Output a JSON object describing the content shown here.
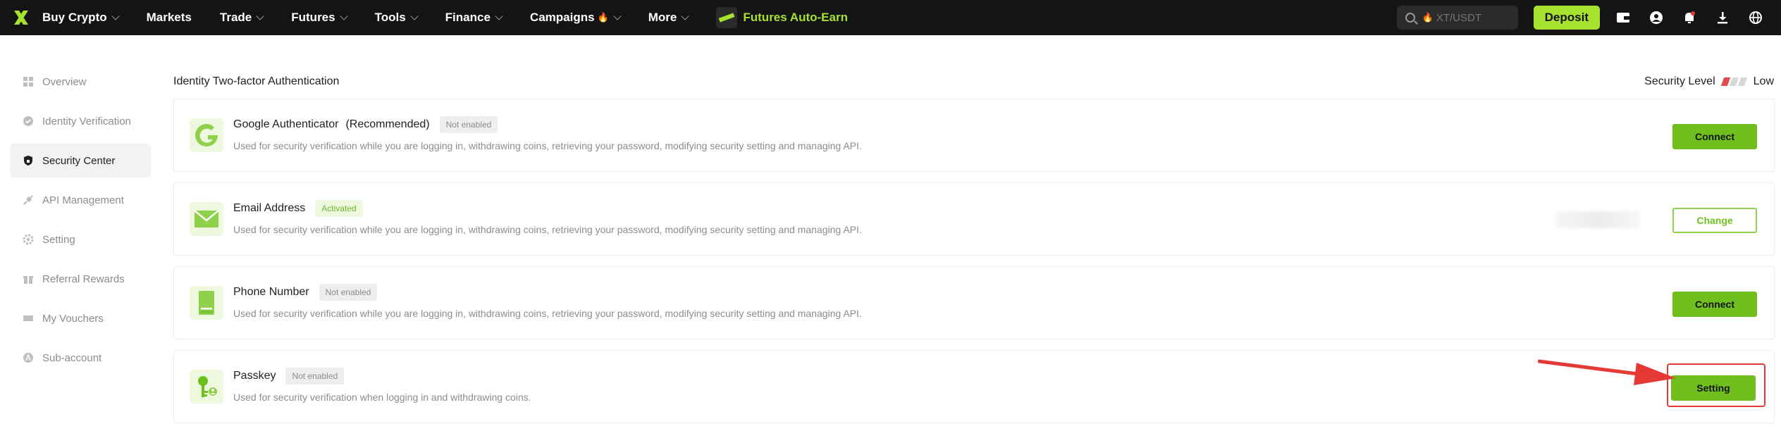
{
  "nav": {
    "items": [
      {
        "label": "Buy Crypto",
        "dropdown": true
      },
      {
        "label": "Markets",
        "dropdown": false
      },
      {
        "label": "Trade",
        "dropdown": true
      },
      {
        "label": "Futures",
        "dropdown": true
      },
      {
        "label": "Tools",
        "dropdown": true
      },
      {
        "label": "Finance",
        "dropdown": true
      },
      {
        "label": "Campaigns",
        "dropdown": true,
        "flame": true
      },
      {
        "label": "More",
        "dropdown": true
      }
    ],
    "promo_label": "Futures Auto-Earn",
    "search_placeholder": "XT/USDT",
    "deposit_label": "Deposit",
    "icons": [
      "wallet-icon",
      "user-icon",
      "bell-icon",
      "download-icon",
      "globe-icon"
    ]
  },
  "sidebar": {
    "items": [
      {
        "label": "Overview",
        "icon": "grid-icon",
        "active": false
      },
      {
        "label": "Identity Verification",
        "icon": "verified-icon",
        "active": false
      },
      {
        "label": "Security Center",
        "icon": "shield-icon",
        "active": true
      },
      {
        "label": "API Management",
        "icon": "api-icon",
        "active": false
      },
      {
        "label": "Setting",
        "icon": "gear-icon",
        "active": false
      },
      {
        "label": "Referral Rewards",
        "icon": "gift-icon",
        "active": false
      },
      {
        "label": "My Vouchers",
        "icon": "ticket-icon",
        "active": false
      },
      {
        "label": "Sub-account",
        "icon": "subaccount-icon",
        "active": false
      }
    ]
  },
  "main": {
    "title": "Identity Two-factor Authentication",
    "security_level_label": "Security Level",
    "security_level_value": "Low",
    "security_level_bars": {
      "filled": 1,
      "total": 3
    },
    "cards": [
      {
        "title": "Google Authenticator",
        "subtitle": "(Recommended)",
        "status": "Not enabled",
        "status_ok": false,
        "desc": "Used for security verification while you are logging in, withdrawing coins, retrieving your password, modifying security setting and managing API.",
        "button": "Connect",
        "icon": "google-authenticator-icon"
      },
      {
        "title": "Email Address",
        "subtitle": "",
        "status": "Activated",
        "status_ok": true,
        "desc": "Used for security verification while you are logging in, withdrawing coins, retrieving your password, modifying security setting and managing API.",
        "button": "Change",
        "icon": "mail-icon"
      },
      {
        "title": "Phone Number",
        "subtitle": "",
        "status": "Not enabled",
        "status_ok": false,
        "desc": "Used for security verification while you are logging in, withdrawing coins, retrieving your password, modifying security setting and managing API.",
        "button": "Connect",
        "icon": "phone-icon"
      },
      {
        "title": "Passkey",
        "subtitle": "",
        "status": "Not enabled",
        "status_ok": false,
        "desc": "Used for security verification when logging in and withdrawing coins.",
        "button": "Setting",
        "icon": "passkey-icon"
      }
    ]
  },
  "colors": {
    "brand": "#a6e22e",
    "button_green": "#6fbf1f",
    "highlight": "#e53935",
    "nav_bg": "#141414"
  }
}
